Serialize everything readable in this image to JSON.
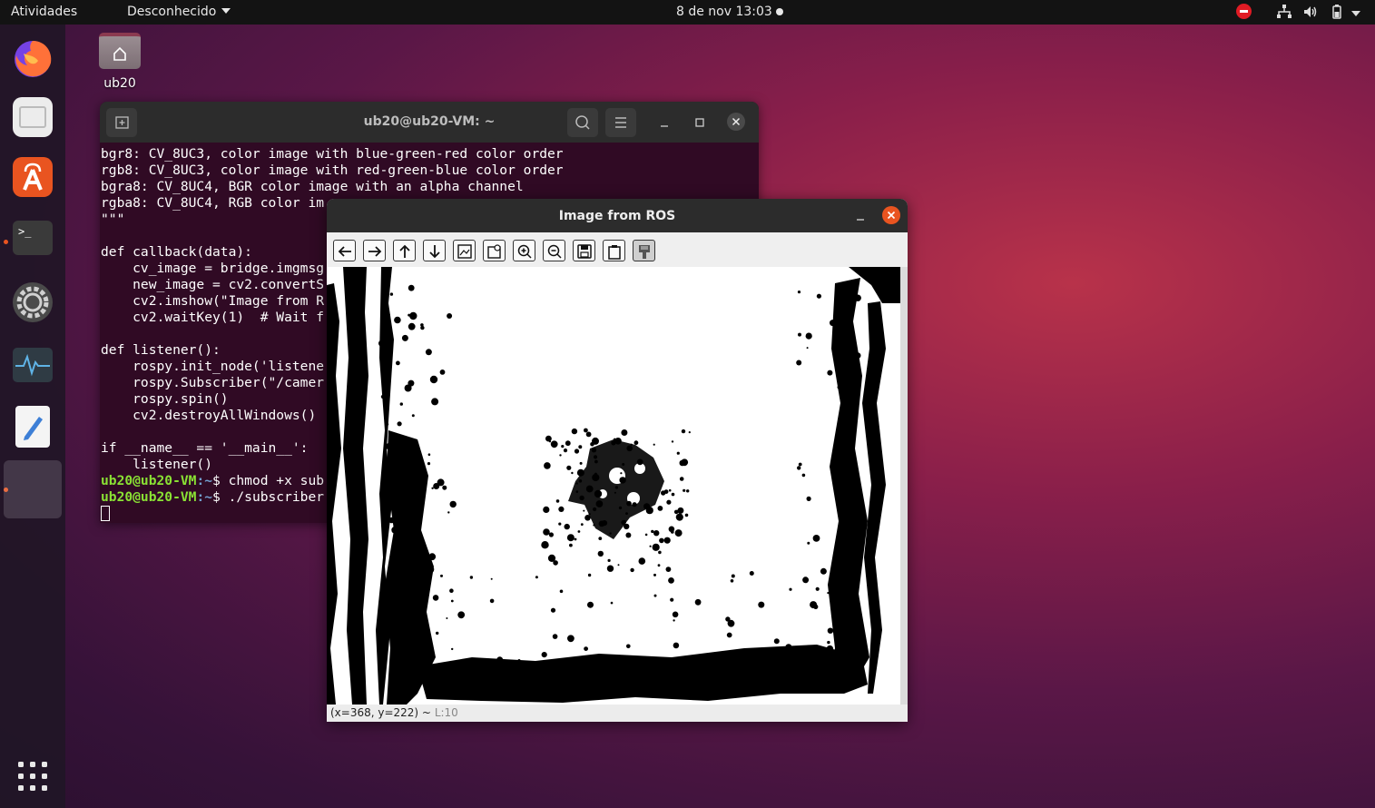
{
  "topbar": {
    "activities": "Atividades",
    "app_menu": "Desconhecido",
    "clock": "8 de nov  13:03"
  },
  "dock": {
    "items": [
      {
        "name": "firefox",
        "icon": "firefox-icon"
      },
      {
        "name": "files",
        "icon": "files-icon"
      },
      {
        "name": "software",
        "icon": "software-center-icon"
      },
      {
        "name": "terminal",
        "icon": "terminal-icon"
      },
      {
        "name": "settings",
        "icon": "gear-icon"
      },
      {
        "name": "system-monitor",
        "icon": "system-monitor-icon"
      },
      {
        "name": "text-editor",
        "icon": "text-editor-icon"
      },
      {
        "name": "running-app",
        "icon": "blank-app-icon"
      }
    ]
  },
  "desktop": {
    "home_label": "ub20"
  },
  "terminal": {
    "title": "ub20@ub20-VM: ~",
    "lines": [
      "bgr8: CV_8UC3, color image with blue-green-red color order",
      "rgb8: CV_8UC3, color image with red-green-blue color order",
      "bgra8: CV_8UC4, BGR color image with an alpha channel",
      "rgba8: CV_8UC4, RGB color im",
      "\"\"\"",
      "",
      "def callback(data):",
      "    cv_image = bridge.imgmsg",
      "    new_image = cv2.convertS",
      "    cv2.imshow(\"Image from R",
      "    cv2.waitKey(1)  # Wait f",
      "",
      "def listener():",
      "    rospy.init_node('listene",
      "    rospy.Subscriber(\"/camer",
      "    rospy.spin()",
      "    cv2.destroyAllWindows()",
      "",
      "if __name__ == '__main__':",
      "    listener()"
    ],
    "prompt_user": "ub20@ub20-VM",
    "prompt_path": ":~",
    "commands": [
      "$ chmod +x sub",
      "$ ./subscriber"
    ]
  },
  "image_window": {
    "title": "Image from ROS",
    "status": "(x=368, y=222) ~",
    "zoom": "L:10",
    "tools": [
      "arrow-left-icon",
      "arrow-right-icon",
      "arrow-up-icon",
      "arrow-down-icon",
      "zoom-fit-icon",
      "zoom-original-icon",
      "zoom-in-icon",
      "zoom-out-icon",
      "save-icon",
      "copy-icon",
      "properties-icon"
    ]
  }
}
